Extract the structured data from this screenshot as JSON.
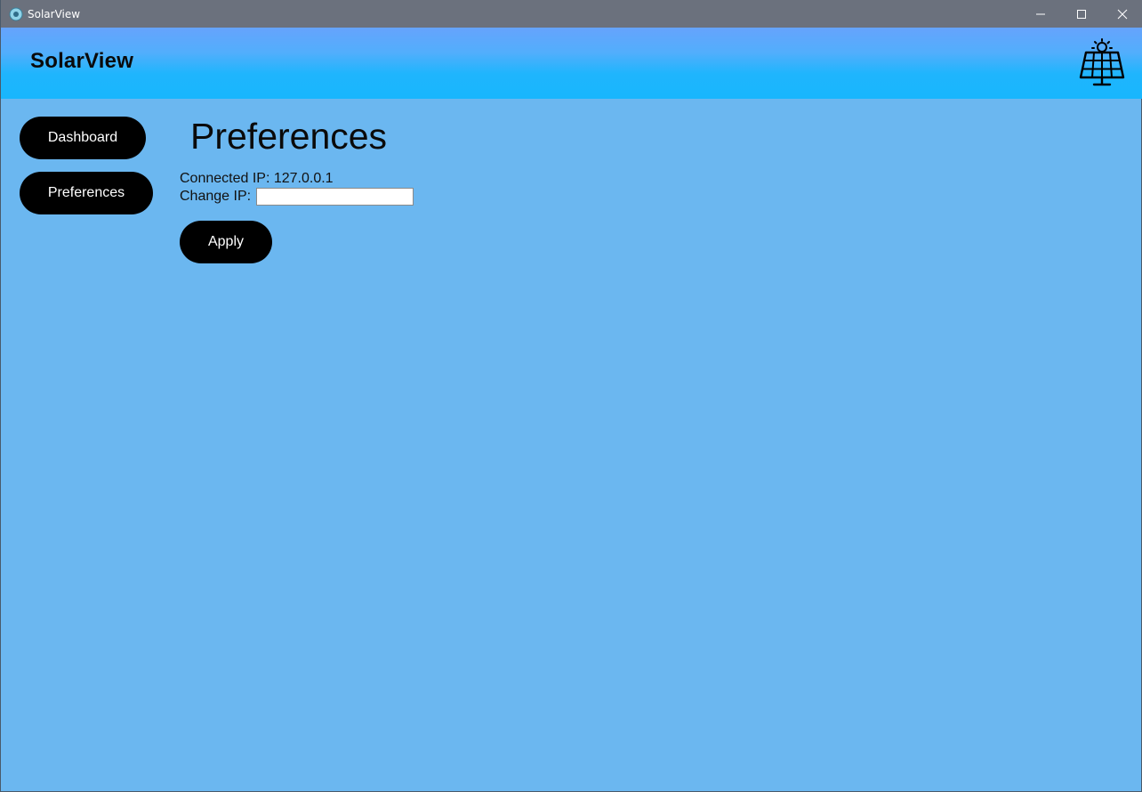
{
  "window": {
    "title": "SolarView",
    "app_icon": "solarview-app-icon",
    "controls": {
      "minimize_icon": "minimize-icon",
      "maximize_icon": "maximize-icon",
      "close_icon": "close-icon"
    }
  },
  "header": {
    "title": "SolarView",
    "logo_icon": "solar-panel-icon"
  },
  "sidebar": {
    "items": [
      {
        "label": "Dashboard"
      },
      {
        "label": "Preferences"
      }
    ]
  },
  "main": {
    "title": "Preferences",
    "connected_ip_label": "Connected IP: 127.0.0.1",
    "change_ip_label": "Change IP:",
    "change_ip_value": "",
    "apply_label": "Apply"
  },
  "colors": {
    "background": "#6bb7f0",
    "header_top": "#66a3fc",
    "header_bottom": "#18b6fd",
    "titlebar": "#6b717d",
    "button": "#000000",
    "button_text": "#ffffff"
  }
}
